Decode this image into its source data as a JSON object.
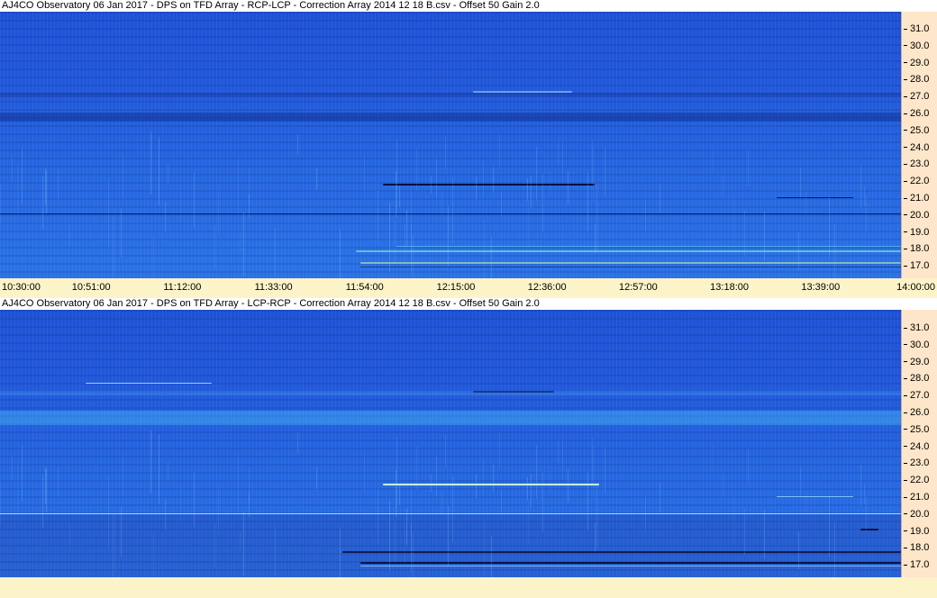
{
  "panels": [
    {
      "title": "AJ4CO Observatory 06 Jan 2017  -  DPS on TFD Array  -  RCP-LCP  -  Correction Array 2014 12 18 B.csv  -  Offset 50  Gain 2.0"
    },
    {
      "title": "AJ4CO Observatory 06 Jan 2017  -  DPS on TFD Array  -  LCP-RCP  -  Correction Array 2014 12 18 B.csv  -  Offset 50  Gain 2.0"
    }
  ],
  "frequency_ticks": [
    "31.0",
    "30.0",
    "29.0",
    "28.0",
    "27.0",
    "26.0",
    "25.0",
    "24.0",
    "23.0",
    "22.0",
    "21.0",
    "20.0",
    "19.0",
    "18.0",
    "17.0"
  ],
  "time_ticks": [
    "10:30:00",
    "10:51:00",
    "11:12:00",
    "11:33:00",
    "11:54:00",
    "12:15:00",
    "12:36:00",
    "12:57:00",
    "13:18:00",
    "13:39:00",
    "14:00:00"
  ],
  "colors": {
    "spectrogram_base": "#2566e0",
    "axis_bg": "#fde6c9",
    "time_axis_bg": "#fdf3c8"
  }
}
